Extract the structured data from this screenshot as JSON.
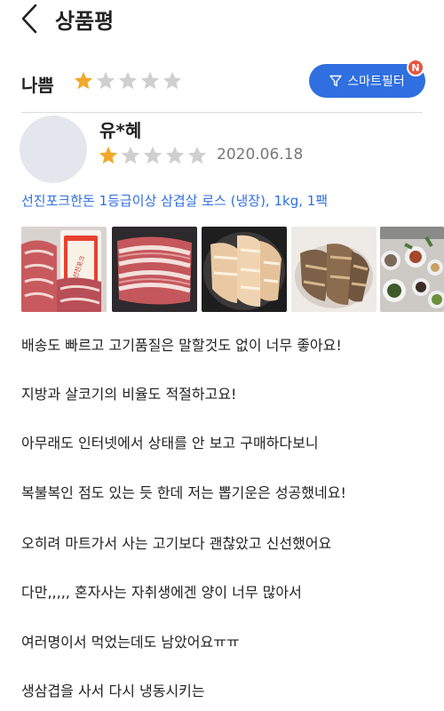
{
  "header": {
    "title": "상품평"
  },
  "filter": {
    "label": "나쁨",
    "rating": 1,
    "max_rating": 5,
    "smart_filter_label": "스마트필터",
    "badge": "N"
  },
  "review": {
    "reviewer": "유*혜",
    "rating": 1,
    "max_rating": 5,
    "date": "2020.06.18",
    "product": "선진포크한돈 1등급이상 삼겹살 로스 (냉장), 1kg, 1팩",
    "photo_package_text": "선진포크",
    "lines": [
      "배송도 빠르고 고기품질은 말할것도 없이 너무 좋아요!",
      "지방과 살코기의 비율도 적절하고요!",
      "아무래도 인터넷에서 상태를 안 보고 구매하다보니",
      "복불복인 점도 있는 듯 한데 저는 뽑기운은 성공했네요!",
      "오히려 마트가서 사는 고기보다 괜찮았고 신선했어요",
      "다만,,,,, 혼자사는 자취생에겐 양이 너무 많아서",
      "여러명이서 먹었는데도 남았어요ㅠㅠ",
      "생삼겹을 사서 다시 냉동시키는"
    ]
  },
  "colors": {
    "accent": "#2f6fe0",
    "star_filled": "#f0a92b",
    "star_empty": "#cfcfcf",
    "badge": "#e5543f"
  }
}
